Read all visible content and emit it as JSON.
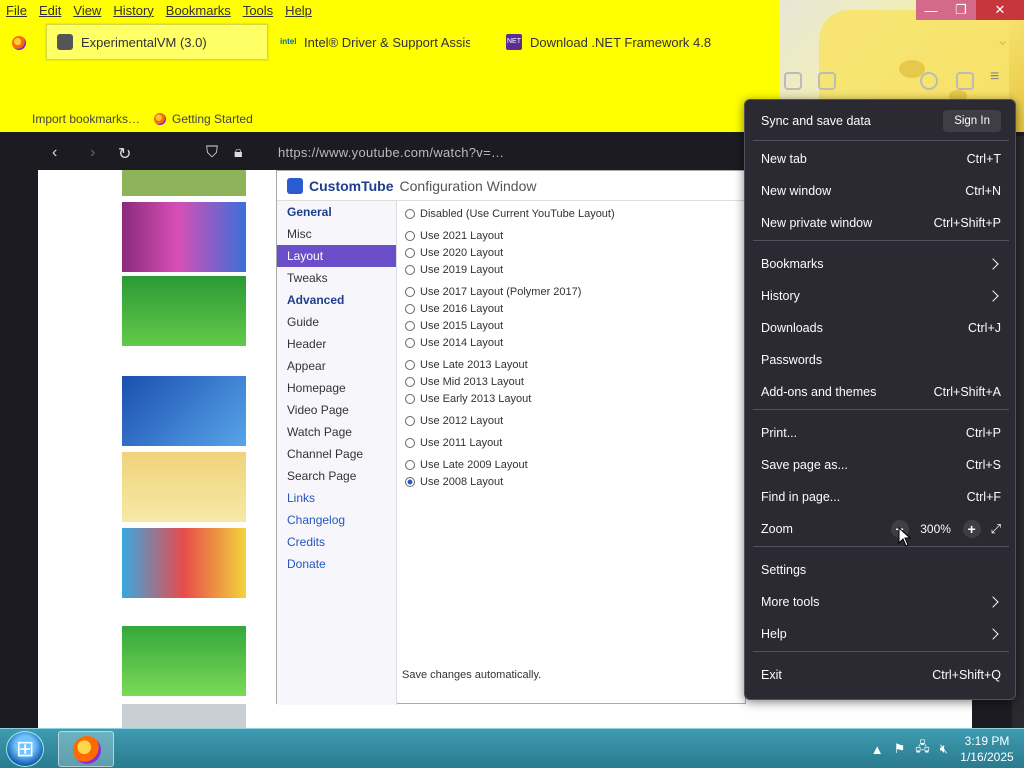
{
  "menubar": [
    "File",
    "Edit",
    "View",
    "History",
    "Bookmarks",
    "Tools",
    "Help"
  ],
  "tabs": [
    {
      "label": "ExperimentalVM (3.0)",
      "active": true,
      "icon": "vm-icon"
    },
    {
      "label": "Intel® Driver & Support Assis…",
      "active": false,
      "icon": "intel-icon"
    },
    {
      "label": "Download .NET Framework 4.8",
      "active": false,
      "icon": "dotnet-icon"
    }
  ],
  "bookmarks": [
    {
      "label": "Import bookmarks…"
    },
    {
      "label": "Getting Started"
    }
  ],
  "vm": {
    "url": "https://www.youtube.com/watch?v=…",
    "ct_brand": "CustomTube",
    "ct_title_rest": "Configuration Window",
    "side": [
      {
        "label": "General",
        "kind": "sec"
      },
      {
        "label": "Misc",
        "kind": "item"
      },
      {
        "label": "Layout",
        "kind": "sel"
      },
      {
        "label": "Tweaks",
        "kind": "item"
      },
      {
        "label": "Advanced",
        "kind": "sec"
      },
      {
        "label": "Guide",
        "kind": "item"
      },
      {
        "label": "Header",
        "kind": "item"
      },
      {
        "label": "Appear",
        "kind": "item"
      },
      {
        "label": "Homepage",
        "kind": "item"
      },
      {
        "label": "Video Page",
        "kind": "item"
      },
      {
        "label": "Watch Page",
        "kind": "item"
      },
      {
        "label": "Channel Page",
        "kind": "item"
      },
      {
        "label": "Search Page",
        "kind": "item"
      },
      {
        "label": "Links",
        "kind": "link"
      },
      {
        "label": "Changelog",
        "kind": "link"
      },
      {
        "label": "Credits",
        "kind": "link"
      },
      {
        "label": "Donate",
        "kind": "link"
      }
    ],
    "options": [
      {
        "label": "Disabled (Use Current YouTube Layout)",
        "on": false,
        "sub": false
      },
      {
        "label": "Use 2021 Layout",
        "on": false,
        "sub": false
      },
      {
        "label": "Use 2020 Layout",
        "on": false,
        "sub": false
      },
      {
        "label": "Use 2019 Layout",
        "on": false,
        "sub": false
      },
      {
        "label": "Use 2017 Layout (Polymer 2017)",
        "on": false,
        "sub": false
      },
      {
        "label": "Use 2016 Layout",
        "on": false,
        "sub": false
      },
      {
        "label": "Use 2015 Layout",
        "on": false,
        "sub": false
      },
      {
        "label": "Use 2014 Layout",
        "on": false,
        "sub": false
      },
      {
        "label": "Use Late 2013 Layout",
        "on": false,
        "sub": false
      },
      {
        "label": "Use Mid 2013 Layout",
        "on": false,
        "sub": false
      },
      {
        "label": "Use Early 2013 Layout",
        "on": false,
        "sub": false
      },
      {
        "label": "Use 2012 Layout",
        "on": false,
        "sub": false
      },
      {
        "label": "Use 2011 Layout",
        "on": false,
        "sub": false
      },
      {
        "label": "Use Late 2009 Layout",
        "on": false,
        "sub": false
      },
      {
        "label": "Use 2008 Layout",
        "on": true,
        "sub": false
      }
    ],
    "footer_note": "Save changes automatically."
  },
  "app_menu": {
    "sync_label": "Sync and save data",
    "sign_in": "Sign In",
    "items": [
      {
        "label": "New tab",
        "shortcut": "Ctrl+T",
        "submenu": false
      },
      {
        "label": "New window",
        "shortcut": "Ctrl+N",
        "submenu": false
      },
      {
        "label": "New private window",
        "shortcut": "Ctrl+Shift+P",
        "submenu": false
      },
      {
        "label": "Bookmarks",
        "shortcut": "",
        "submenu": true
      },
      {
        "label": "History",
        "shortcut": "",
        "submenu": true
      },
      {
        "label": "Downloads",
        "shortcut": "Ctrl+J",
        "submenu": false
      },
      {
        "label": "Passwords",
        "shortcut": "",
        "submenu": false
      },
      {
        "label": "Add-ons and themes",
        "shortcut": "Ctrl+Shift+A",
        "submenu": false
      },
      {
        "label": "Print...",
        "shortcut": "Ctrl+P",
        "submenu": false
      },
      {
        "label": "Save page as...",
        "shortcut": "Ctrl+S",
        "submenu": false
      },
      {
        "label": "Find in page...",
        "shortcut": "Ctrl+F",
        "submenu": false
      },
      {
        "label": "Settings",
        "shortcut": "",
        "submenu": false
      },
      {
        "label": "More tools",
        "shortcut": "",
        "submenu": true
      },
      {
        "label": "Help",
        "shortcut": "",
        "submenu": true
      },
      {
        "label": "Exit",
        "shortcut": "Ctrl+Shift+Q",
        "submenu": false
      }
    ],
    "zoom": {
      "label": "Zoom",
      "minus": "−",
      "value": "300%",
      "plus": "+",
      "fullscreen": "⤢"
    }
  },
  "taskbar": {
    "time": "3:19 PM",
    "date": "1/16/2025"
  },
  "window_controls": {
    "minimize": "—",
    "maximize": "❐",
    "close": "✕"
  }
}
